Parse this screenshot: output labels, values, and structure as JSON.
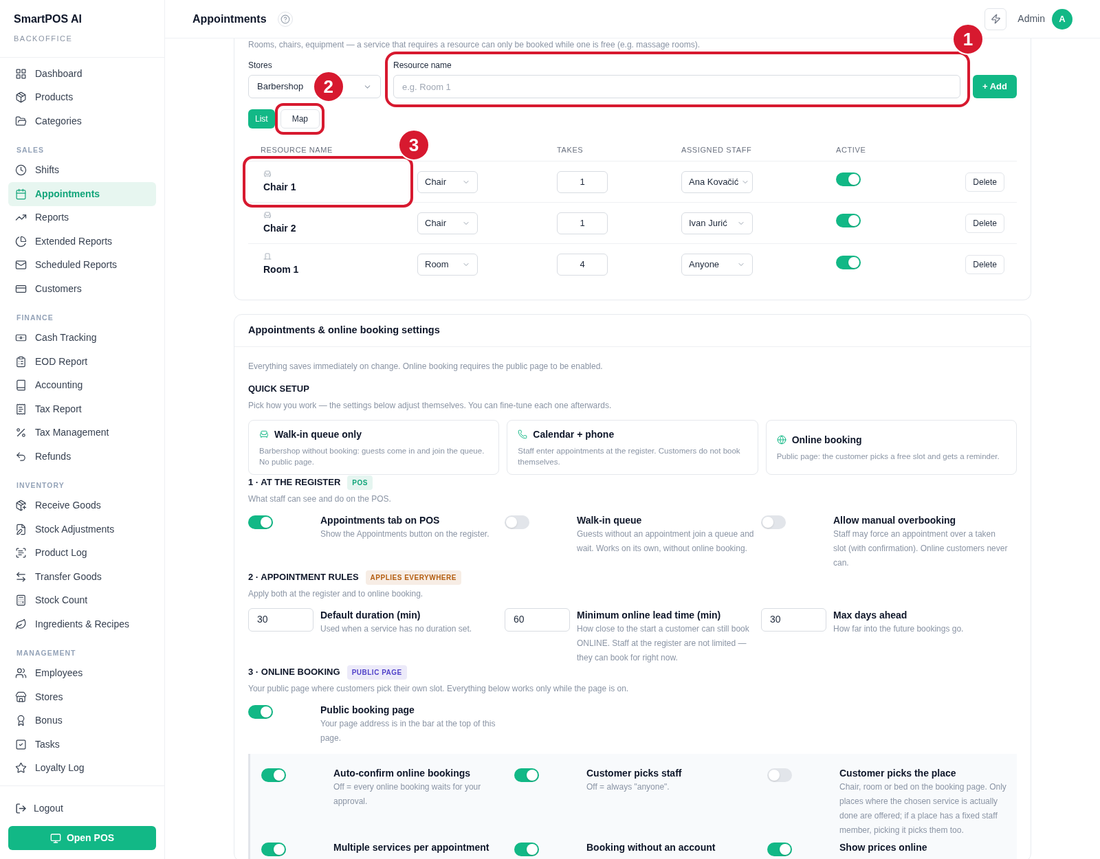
{
  "sidebar": {
    "brand": "SmartPOS AI",
    "subtitle": "BACKOFFICE",
    "sections": [
      {
        "items": [
          {
            "label": "Dashboard",
            "selected": false
          },
          {
            "label": "Products",
            "selected": false
          },
          {
            "label": "Categories",
            "selected": false
          }
        ]
      },
      {
        "title": "SALES",
        "items": [
          {
            "label": "Shifts",
            "selected": false
          },
          {
            "label": "Appointments",
            "selected": true
          },
          {
            "label": "Reports",
            "selected": false
          },
          {
            "label": "Extended Reports",
            "selected": false
          },
          {
            "label": "Scheduled Reports",
            "selected": false
          },
          {
            "label": "Customers",
            "selected": false
          }
        ]
      },
      {
        "title": "FINANCE",
        "items": [
          {
            "label": "Cash Tracking",
            "selected": false
          },
          {
            "label": "EOD Report",
            "selected": false
          },
          {
            "label": "Accounting",
            "selected": false
          },
          {
            "label": "Tax Report",
            "selected": false
          },
          {
            "label": "Tax Management",
            "selected": false
          },
          {
            "label": "Refunds",
            "selected": false
          }
        ]
      },
      {
        "title": "INVENTORY",
        "items": [
          {
            "label": "Receive Goods",
            "selected": false
          },
          {
            "label": "Stock Adjustments",
            "selected": false
          },
          {
            "label": "Product Log",
            "selected": false
          },
          {
            "label": "Transfer Goods",
            "selected": false
          },
          {
            "label": "Stock Count",
            "selected": false
          },
          {
            "label": "Ingredients & Recipes",
            "selected": false
          }
        ]
      },
      {
        "title": "MANAGEMENT",
        "items": [
          {
            "label": "Employees",
            "selected": false
          },
          {
            "label": "Stores",
            "selected": false
          },
          {
            "label": "Bonus",
            "selected": false
          },
          {
            "label": "Tasks",
            "selected": false
          },
          {
            "label": "Loyalty Log",
            "selected": false
          }
        ]
      }
    ],
    "logout": "Logout",
    "open_pos": "Open POS"
  },
  "header": {
    "title": "Appointments",
    "user": "Admin",
    "avatar": "A"
  },
  "resources": {
    "description": "Rooms, chairs, equipment — a service that requires a resource can only be booked while one is free (e.g. massage rooms).",
    "stores_label": "Stores",
    "store_value": "Barbershop",
    "name_label": "Resource name",
    "name_placeholder": "e.g. Room 1",
    "add_button": "+ Add",
    "views": [
      {
        "label": "List",
        "selected": true
      },
      {
        "label": "Map",
        "selected": false
      }
    ],
    "columns": {
      "name": "RESOURCE NAME",
      "takes": "TAKES",
      "staff": "ASSIGNED STAFF",
      "active": "ACTIVE"
    },
    "rows": [
      {
        "kind": "chair",
        "name": "Chair 1",
        "type": "Chair",
        "takes": "1",
        "staff": "Ana Kovačić",
        "active": true,
        "delete": "Delete"
      },
      {
        "kind": "chair",
        "name": "Chair 2",
        "type": "Chair",
        "takes": "1",
        "staff": "Ivan Jurić",
        "active": true,
        "delete": "Delete"
      },
      {
        "kind": "room",
        "name": "Room 1",
        "type": "Room",
        "takes": "4",
        "staff": "Anyone",
        "active": true,
        "delete": "Delete"
      }
    ]
  },
  "annotations": [
    "1",
    "2",
    "3"
  ],
  "settings": {
    "title": "Appointments & online booking settings",
    "note": "Everything saves immediately on change. Online booking requires the public page to be enabled.",
    "quick_setup": {
      "title": "QUICK SETUP",
      "hint": "Pick how you work — the settings below adjust themselves. You can fine-tune each one afterwards.",
      "options": [
        {
          "title": "Walk-in queue only",
          "description": "Barbershop without booking: guests come in and join the queue. No public page."
        },
        {
          "title": "Calendar + phone",
          "description": "Staff enter appointments at the register. Customers do not book themselves."
        },
        {
          "title": "Online booking",
          "description": "Public page: the customer picks a free slot and gets a reminder."
        }
      ]
    },
    "sections": [
      {
        "title": "1 · AT THE REGISTER",
        "badge": "POS",
        "color": "#12a57a",
        "hint": "What staff can see and do on the POS.",
        "items": [
          {
            "kind": "toggle",
            "on": true,
            "title": "Appointments tab on POS",
            "description": "Show the Appointments button on the register."
          },
          {
            "kind": "toggle",
            "on": false,
            "title": "Walk-in queue",
            "description": "Guests without an appointment join a queue and wait. Works on its own, without online booking."
          },
          {
            "kind": "toggle",
            "on": false,
            "title": "Allow manual overbooking",
            "description": "Staff may force an appointment over a taken slot (with confirmation). Online customers never can."
          }
        ]
      },
      {
        "title": "2 · APPOINTMENT RULES",
        "badge": "APPLIES EVERYWHERE",
        "color": "#b45e10",
        "hint": "Apply both at the register and to online booking.",
        "items": [
          {
            "kind": "number",
            "value": "30",
            "title": "Default duration (min)",
            "description": "Used when a service has no duration set."
          },
          {
            "kind": "number",
            "value": "60",
            "title": "Minimum online lead time (min)",
            "description": "How close to the start a customer can still book ONLINE. Staff at the register are not limited — they can book for right now."
          },
          {
            "kind": "number",
            "value": "30",
            "title": "Max days ahead",
            "description": "How far into the future bookings go."
          }
        ]
      },
      {
        "title": "3 · ONLINE BOOKING",
        "badge": "PUBLIC PAGE",
        "color": "#5141c9",
        "hint": "Your public page where customers pick their own slot. Everything below works only while the page is on.",
        "items": [
          {
            "kind": "toggle",
            "on": true,
            "title": "Public booking page",
            "description": "Your page address is in the bar at the top of this page."
          }
        ],
        "group": [
          {
            "kind": "toggle",
            "on": true,
            "title": "Auto-confirm online bookings",
            "description": "Off = every online booking waits for your approval."
          },
          {
            "kind": "toggle",
            "on": true,
            "title": "Customer picks staff",
            "description": "Off = always \"anyone\"."
          },
          {
            "kind": "toggle",
            "on": false,
            "title": "Customer picks the place",
            "description": "Chair, room or bed on the booking page. Only places where the chosen service is actually done are offered; if a place has a fixed staff member, picking it picks them too."
          },
          {
            "kind": "toggle",
            "on": true,
            "title": "Multiple services per appointment"
          },
          {
            "kind": "toggle",
            "on": true,
            "title": "Booking without an account"
          },
          {
            "kind": "toggle",
            "on": true,
            "title": "Show prices online"
          }
        ]
      }
    ]
  }
}
